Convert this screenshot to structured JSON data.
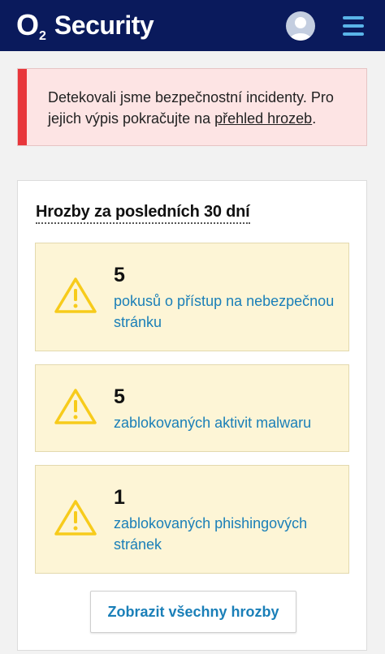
{
  "header": {
    "logo_o": "O",
    "logo_two": "2",
    "app_name": "Security",
    "avatar_icon": "user-avatar-icon",
    "menu_icon": "hamburger-menu-icon"
  },
  "alert": {
    "text_before": "Detekovali jsme bezpečnostní incidenty. Pro jejich výpis pokračujte na ",
    "link_text": "přehled hrozeb",
    "text_after": ".",
    "accent_color": "#e8363b"
  },
  "threats_card": {
    "title": "Hrozby za posledních 30 dní",
    "items": [
      {
        "count": "5",
        "label": "pokusů o přístup na nebezpečnou stránku",
        "icon": "warning-icon"
      },
      {
        "count": "5",
        "label": "zablokovaných aktivit malwaru",
        "icon": "warning-icon"
      },
      {
        "count": "1",
        "label": "zablokovaných phishingových stránek",
        "icon": "warning-icon"
      }
    ],
    "show_all_label": "Zobrazit všechny hrozby"
  },
  "colors": {
    "header_bg": "#0a1a5c",
    "link_blue": "#1a7fb8",
    "warning_yellow": "#f7cb1b",
    "threat_bg": "#fdf5d6"
  }
}
